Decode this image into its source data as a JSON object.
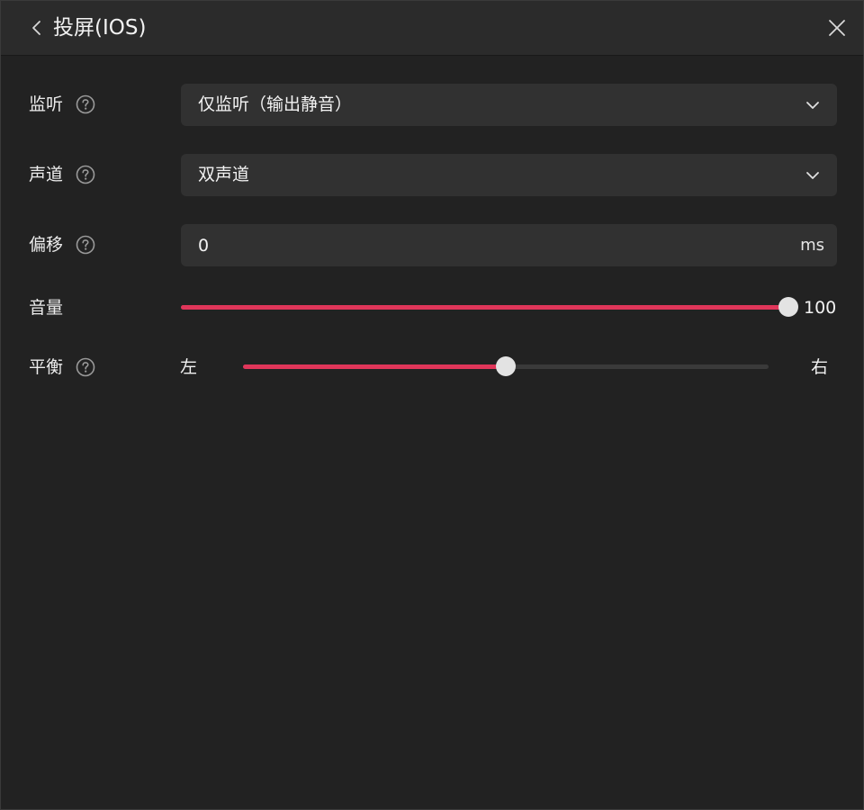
{
  "window": {
    "title": "投屏(IOS)"
  },
  "colors": {
    "accent": "#e0365a",
    "background": "#222222",
    "field": "#313131",
    "titlebar": "#2b2b2b"
  },
  "icons": {
    "back": "chevron-left-icon",
    "close": "close-icon",
    "help": "question-circle-icon",
    "dropdown": "chevron-down-icon"
  },
  "settings": {
    "monitor": {
      "label": "监听",
      "selected": "仅监听（输出静音）"
    },
    "channel": {
      "label": "声道",
      "selected": "双声道"
    },
    "offset": {
      "label": "偏移",
      "value": "0",
      "unit": "ms"
    },
    "volume": {
      "label": "音量",
      "value": 100,
      "value_text": "100",
      "max": 100
    },
    "balance": {
      "label": "平衡",
      "left_label": "左",
      "right_label": "右",
      "fraction": 0.5
    }
  }
}
